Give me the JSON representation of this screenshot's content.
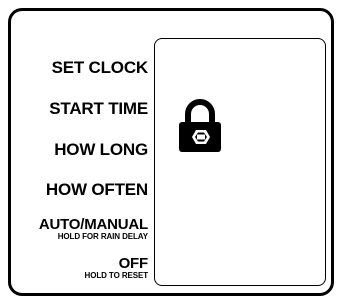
{
  "modes": [
    {
      "label": "SET CLOCK",
      "sublabel": ""
    },
    {
      "label": "START TIME",
      "sublabel": ""
    },
    {
      "label": "HOW LONG",
      "sublabel": ""
    },
    {
      "label": "HOW OFTEN",
      "sublabel": ""
    },
    {
      "label": "AUTO/MANUAL",
      "sublabel": "HOLD FOR RAIN DELAY"
    },
    {
      "label": "OFF",
      "sublabel": "HOLD TO RESET"
    }
  ],
  "display": {
    "icon": "lock-icon"
  },
  "colors": {
    "ink": "#000000",
    "background": "#ffffff"
  }
}
